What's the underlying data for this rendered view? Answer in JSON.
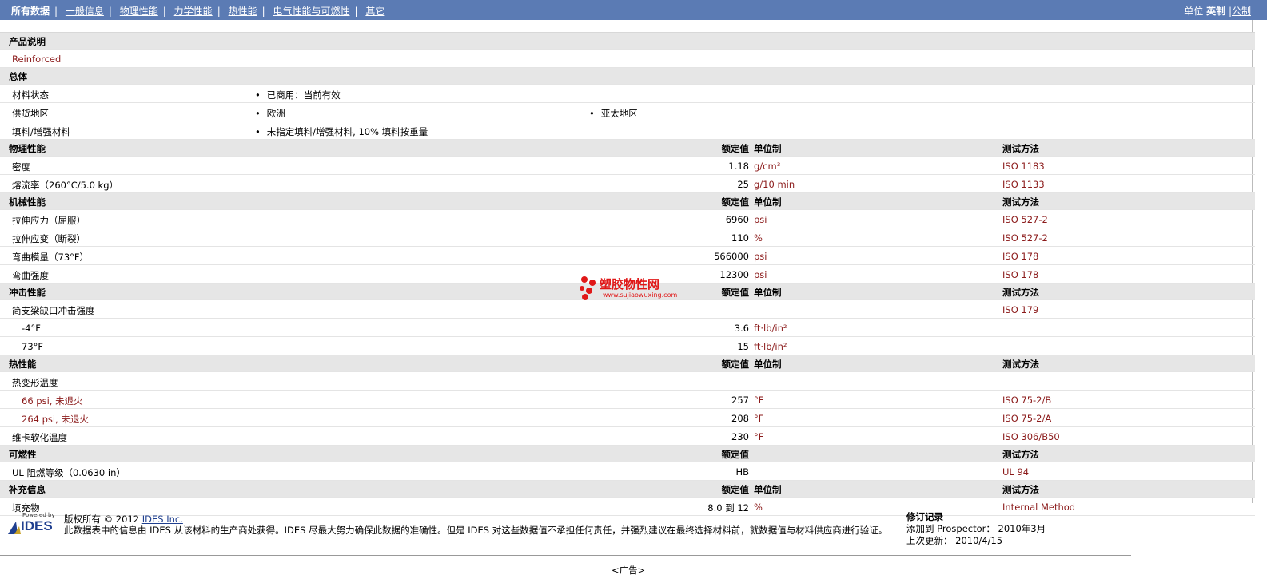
{
  "topbar": {
    "tabs": [
      "所有数据",
      "一般信息",
      "物理性能",
      "力学性能",
      "热性能",
      "电气性能与可燃性",
      "其它"
    ],
    "units_label": "单位",
    "unit_imperial": "英制",
    "unit_sep": "|",
    "unit_metric": "公制"
  },
  "sections": {
    "desc": {
      "title": "产品说明",
      "text": "Reinforced"
    },
    "general": {
      "title": "总体",
      "material_state_label": "材料状态",
      "material_state_value": "已商用：当前有效",
      "supply_label": "供货地区",
      "supply_v1": "欧洲",
      "supply_v2": "亚太地区",
      "filler_label": "填料/增强材料",
      "filler_value": "未指定填料/增强材料, 10% 填料按重量"
    },
    "physical": {
      "title": "物理性能",
      "rows": [
        {
          "label": "密度",
          "value": "1.18",
          "unit": "g/cm³",
          "method": "ISO 1183"
        },
        {
          "label": "熔流率（260°C/5.0 kg）",
          "value": "25",
          "unit": "g/10 min",
          "method": "ISO 1133"
        }
      ]
    },
    "mechanical": {
      "title": "机械性能",
      "rows": [
        {
          "label": "拉伸应力（屈服）",
          "value": "6960",
          "unit": "psi",
          "method": "ISO 527-2"
        },
        {
          "label": "拉伸应变（断裂）",
          "value": "110",
          "unit": "%",
          "method": "ISO 527-2"
        },
        {
          "label": "弯曲模量（73°F）",
          "value": "566000",
          "unit": "psi",
          "method": "ISO 178"
        },
        {
          "label": "弯曲强度",
          "value": "12300",
          "unit": "psi",
          "method": "ISO 178"
        }
      ]
    },
    "impact": {
      "title": "冲击性能",
      "label": "简支梁缺口冲击强度",
      "method": "ISO 179",
      "rows": [
        {
          "label": "-4°F",
          "value": "3.6",
          "unit": "ft·lb/in²"
        },
        {
          "label": "73°F",
          "value": "15",
          "unit": "ft·lb/in²"
        }
      ]
    },
    "thermal": {
      "title": "热性能",
      "hdt_label": "热变形温度",
      "rows": [
        {
          "label": "66 psi, 未退火",
          "value": "257",
          "unit": "°F",
          "method": "ISO 75-2/B"
        },
        {
          "label": "264 psi, 未退火",
          "value": "208",
          "unit": "°F",
          "method": "ISO 75-2/A"
        }
      ],
      "vicat": {
        "label": "维卡软化温度",
        "value": "230",
        "unit": "°F",
        "method": "ISO 306/B50"
      }
    },
    "flammability": {
      "title": "可燃性",
      "row": {
        "label": "UL 阻燃等级（0.0630 in）",
        "value": "HB",
        "method": "UL 94"
      }
    },
    "additional": {
      "title": "补充信息",
      "row": {
        "label": "填充物",
        "value": "8.0 到  12",
        "unit": "%",
        "method": "Internal Method"
      }
    }
  },
  "columns": {
    "rated": "额定值",
    "unit_system": "单位制",
    "method": "测试方法"
  },
  "footer": {
    "powered_by": "Powered by",
    "logo_text": "IDES",
    "copyright": "版权所有 © 2012",
    "ides_link": "IDES Inc.",
    "disclaimer": "此数据表中的信息由  IDES 从该材料的生产商处获得。IDES 尽最大努力确保此数据的准确性。但是  IDES 对这些数据值不承担任何责任，并强烈建议在最终选择材料前，就数据值与材料供应商进行验证。",
    "rev_title": "修订记录",
    "rev_added": "添加到  Prospector：  2010年3月",
    "rev_updated": "上次更新：    2010/4/15",
    "ad": "<广告>"
  },
  "watermark": {
    "cn": "塑胶物性网",
    "url": "www.sujiaowuxing.com"
  },
  "colors": {
    "topbar": "#5b7bb4",
    "header_row": "#e6e6e6",
    "watermark": "#e01818"
  }
}
